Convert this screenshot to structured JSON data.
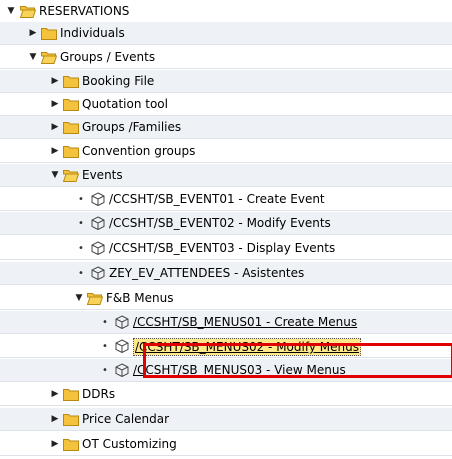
{
  "colors": {
    "folder": "#f4c23c",
    "highlight_border": "#e00000",
    "selection": "#ffe88a"
  },
  "tree": [
    {
      "label": "RESERVATIONS",
      "depth": 0,
      "kind": "folder",
      "open": true
    },
    {
      "label": "Individuals",
      "depth": 1,
      "kind": "folder",
      "open": false
    },
    {
      "label": "Groups / Events",
      "depth": 1,
      "kind": "folder",
      "open": true
    },
    {
      "label": "Booking File",
      "depth": 2,
      "kind": "folder",
      "open": false
    },
    {
      "label": "Quotation tool",
      "depth": 2,
      "kind": "folder",
      "open": false
    },
    {
      "label": "Groups /Families",
      "depth": 2,
      "kind": "folder",
      "open": false
    },
    {
      "label": "Convention groups",
      "depth": 2,
      "kind": "folder",
      "open": false
    },
    {
      "label": "Events",
      "depth": 2,
      "kind": "folder",
      "open": true
    },
    {
      "label": "/CCSHT/SB_EVENT01 - Create Event",
      "depth": 3,
      "kind": "transaction"
    },
    {
      "label": "/CCSHT/SB_EVENT02 - Modify Events",
      "depth": 3,
      "kind": "transaction"
    },
    {
      "label": "/CCSHT/SB_EVENT03 - Display Events",
      "depth": 3,
      "kind": "transaction"
    },
    {
      "label": "ZEY_EV_ATTENDEES - Asistentes",
      "depth": 3,
      "kind": "transaction"
    },
    {
      "label": "F&B Menus",
      "depth": 3,
      "kind": "folder",
      "open": true
    },
    {
      "label": "/CCSHT/SB_MENUS01 - Create Menus",
      "depth": 4,
      "kind": "transaction",
      "link": true
    },
    {
      "label": "/CCSHT/SB_MENUS02 - Modify Menus",
      "depth": 4,
      "kind": "transaction",
      "link": true,
      "selected": true
    },
    {
      "label": "/CCSHT/SB_MENUS03 - View Menus",
      "depth": 4,
      "kind": "transaction",
      "link": true
    },
    {
      "label": "DDRs",
      "depth": 2,
      "kind": "folder",
      "open": false
    },
    {
      "label": "Price Calendar",
      "depth": 2,
      "kind": "folder",
      "open": false
    },
    {
      "label": "OT Customizing",
      "depth": 2,
      "kind": "folder",
      "open": false
    }
  ]
}
